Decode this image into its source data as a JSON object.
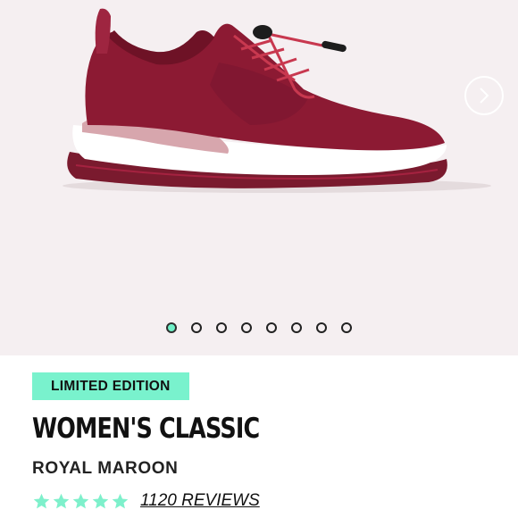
{
  "product": {
    "badge": "LIMITED EDITION",
    "title": "WOMEN'S CLASSIC",
    "color_name": "ROYAL MAROON",
    "rating": 5,
    "rating_max": 5,
    "reviews_label": "1120 REVIEWS"
  },
  "gallery": {
    "image_count": 8,
    "active_index": 0,
    "next_icon": "chevron-right-icon"
  },
  "colors": {
    "background": "#f5eff1",
    "shoe_upper": "#8c1a33",
    "accent": "#79f2cd",
    "star": "#7ef0cb"
  }
}
